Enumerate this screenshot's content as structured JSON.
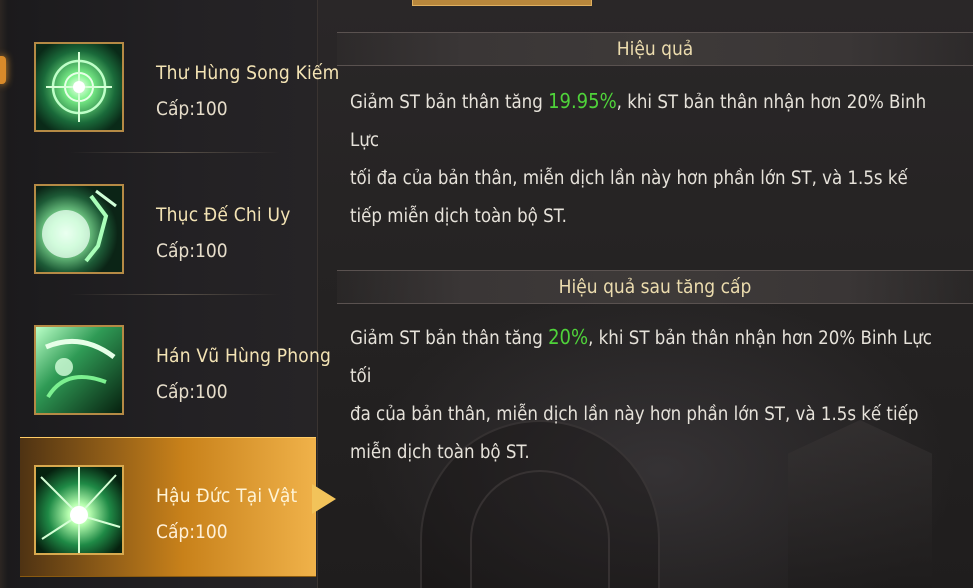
{
  "skills": [
    {
      "name": "Thư Hùng Song Kiếm",
      "level": "Cấp:100",
      "icon": "twin-swords-skill-icon",
      "selected": false
    },
    {
      "name": "Thục Đế Chi Uy",
      "level": "Cấp:100",
      "icon": "emperor-might-skill-icon",
      "selected": false
    },
    {
      "name": "Hán Vũ Hùng Phong",
      "level": "Cấp:100",
      "icon": "wind-martial-skill-icon",
      "selected": false
    },
    {
      "name": "Hậu Đức Tại Vật",
      "level": "Cấp:100",
      "icon": "virtue-burst-skill-icon",
      "selected": true
    }
  ],
  "effect": {
    "title": "Hiệu quả",
    "line1_pre": "Giảm ST bản thân tăng ",
    "line1_value": "19.95%",
    "line1_post": ", khi ST bản thân nhận hơn 20% Binh Lực",
    "line2": "tối đa của bản thân, miễn dịch lần này hơn phần lớn ST, và 1.5s kế",
    "line3": "tiếp miễn dịch toàn bộ ST."
  },
  "upgrade_effect": {
    "title": "Hiệu quả sau tăng cấp",
    "line1_pre": "Giảm ST bản thân tăng ",
    "line1_value": "20%",
    "line1_post": ", khi ST bản thân nhận hơn 20% Binh Lực tối",
    "line2": "đa của bản thân, miễn dịch lần này hơn phần lớn ST, và 1.5s kế tiếp",
    "line3": "miễn dịch toàn bộ ST."
  },
  "colors": {
    "highlight": "#4fd33a",
    "selected": "#e0a23a",
    "title_text": "#ecdcae"
  }
}
